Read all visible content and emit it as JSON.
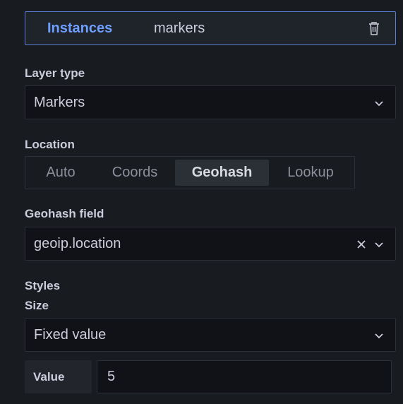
{
  "instances": {
    "label": "Instances",
    "name": "markers"
  },
  "layer_type": {
    "label": "Layer type",
    "value": "Markers"
  },
  "location": {
    "label": "Location",
    "options": [
      "Auto",
      "Coords",
      "Geohash",
      "Lookup"
    ],
    "selected": "Geohash"
  },
  "geohash_field": {
    "label": "Geohash field",
    "value": "geoip.location"
  },
  "styles": {
    "label": "Styles",
    "size_label": "Size",
    "size_mode": "Fixed value",
    "value_label": "Value",
    "value": "5"
  },
  "colors": {
    "accent": "#6e9fff",
    "border_active": "#5b7fd6",
    "background": "#181b1f",
    "input_bg": "#111217"
  }
}
